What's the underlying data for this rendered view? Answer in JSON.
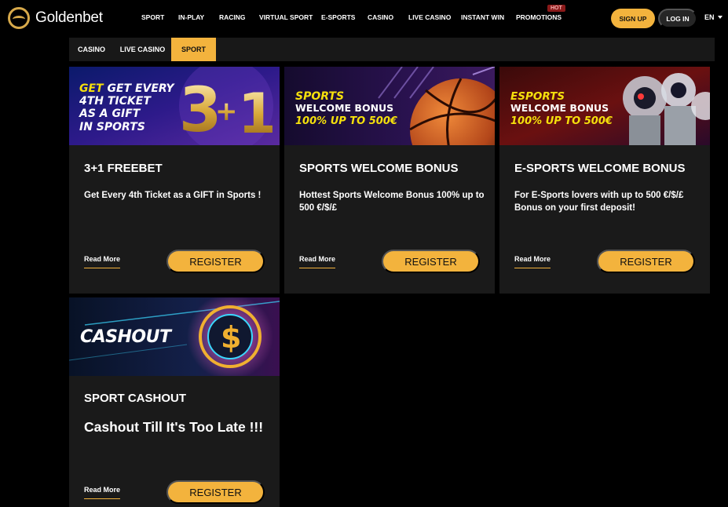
{
  "header": {
    "brand": "Goldenbet",
    "nav": [
      {
        "label": "SPORT"
      },
      {
        "label": "IN-PLAY"
      },
      {
        "label": "RACING"
      },
      {
        "label": "VIRTUAL SPORT"
      },
      {
        "label": "E-SPORTS"
      },
      {
        "label": "CASINO"
      },
      {
        "label": "LIVE CASINO"
      },
      {
        "label": "INSTANT WIN"
      },
      {
        "label": "PROMOTIONS"
      }
    ],
    "hot_badge": "HOT",
    "signup_label": "SIGN UP",
    "login_label": "LOG IN",
    "language": "EN"
  },
  "tabs": [
    {
      "label": "CASINO",
      "active": false
    },
    {
      "label": "LIVE CASINO",
      "active": false
    },
    {
      "label": "SPORT",
      "active": true
    }
  ],
  "cards": [
    {
      "title": "3+1 FREEBET",
      "description": "Get Every 4th Ticket as a GIFT in Sports !",
      "read_more": "Read More",
      "register": "REGISTER",
      "banner": {
        "line1": "GET EVERY",
        "line2": "4TH TICKET",
        "line3": "AS A GIFT",
        "line4": "IN SPORTS",
        "graphic": "3+1"
      }
    },
    {
      "title": "SPORTS WELCOME BONUS",
      "description": "Hottest Sports Welcome Bonus 100% up to 500 €/$/£",
      "read_more": "Read More",
      "register": "REGISTER",
      "banner": {
        "line1": "SPORTS",
        "line2": "WELCOME BONUS",
        "line3": "100% UP TO 500€"
      }
    },
    {
      "title": "E-SPORTS WELCOME BONUS",
      "description": "For E-Sports lovers with up to 500 €/$/£ Bonus on your first deposit!",
      "read_more": "Read More",
      "register": "REGISTER",
      "banner": {
        "line1": "ESPORTS",
        "line2": "WELCOME BONUS",
        "line3": "100% UP TO 500€"
      }
    },
    {
      "title": "SPORT CASHOUT",
      "description": "Cashout Till It's Too Late !!!",
      "read_more": "Read More",
      "register": "REGISTER",
      "banner": {
        "line1": "CASHOUT"
      }
    }
  ],
  "colors": {
    "accent": "#f3b33d",
    "card_bg": "#1a1a1a",
    "page_bg": "#000000"
  }
}
